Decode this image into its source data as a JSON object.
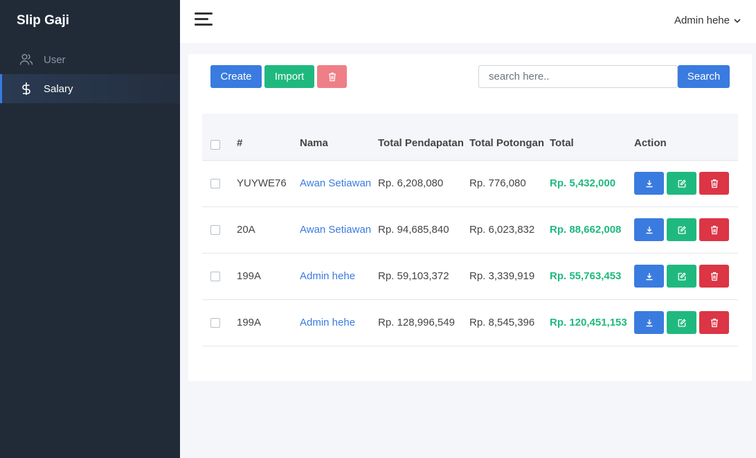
{
  "app": {
    "title": "Slip Gaji"
  },
  "sidebar": {
    "items": [
      {
        "label": "User",
        "icon": "users-icon"
      },
      {
        "label": "Salary",
        "icon": "dollar-icon"
      }
    ]
  },
  "header": {
    "user_name": "Admin hehe"
  },
  "toolbar": {
    "create_label": "Create",
    "import_label": "Import",
    "search_placeholder": "search here..",
    "search_label": "Search"
  },
  "table": {
    "headers": {
      "id": "#",
      "nama": "Nama",
      "pendapatan": "Total Pendapatan",
      "potongan": "Total Potongan",
      "total": "Total",
      "action": "Action"
    },
    "rows": [
      {
        "id": "YUYWE76",
        "nama": "Awan Setiawan",
        "pendapatan": "Rp. 6,208,080",
        "potongan": "Rp. 776,080",
        "total": "Rp. 5,432,000"
      },
      {
        "id": "20A",
        "nama": "Awan Setiawan",
        "pendapatan": "Rp. 94,685,840",
        "potongan": "Rp. 6,023,832",
        "total": "Rp. 88,662,008"
      },
      {
        "id": "199A",
        "nama": "Admin hehe",
        "pendapatan": "Rp. 59,103,372",
        "potongan": "Rp. 3,339,919",
        "total": "Rp. 55,763,453"
      },
      {
        "id": "199A",
        "nama": "Admin hehe",
        "pendapatan": "Rp. 128,996,549",
        "potongan": "Rp. 8,545,396",
        "total": "Rp. 120,451,153"
      }
    ]
  },
  "colors": {
    "sidebar_bg": "#212b38",
    "primary": "#3a7be0",
    "success": "#1fb97f",
    "danger": "#dc3545"
  }
}
